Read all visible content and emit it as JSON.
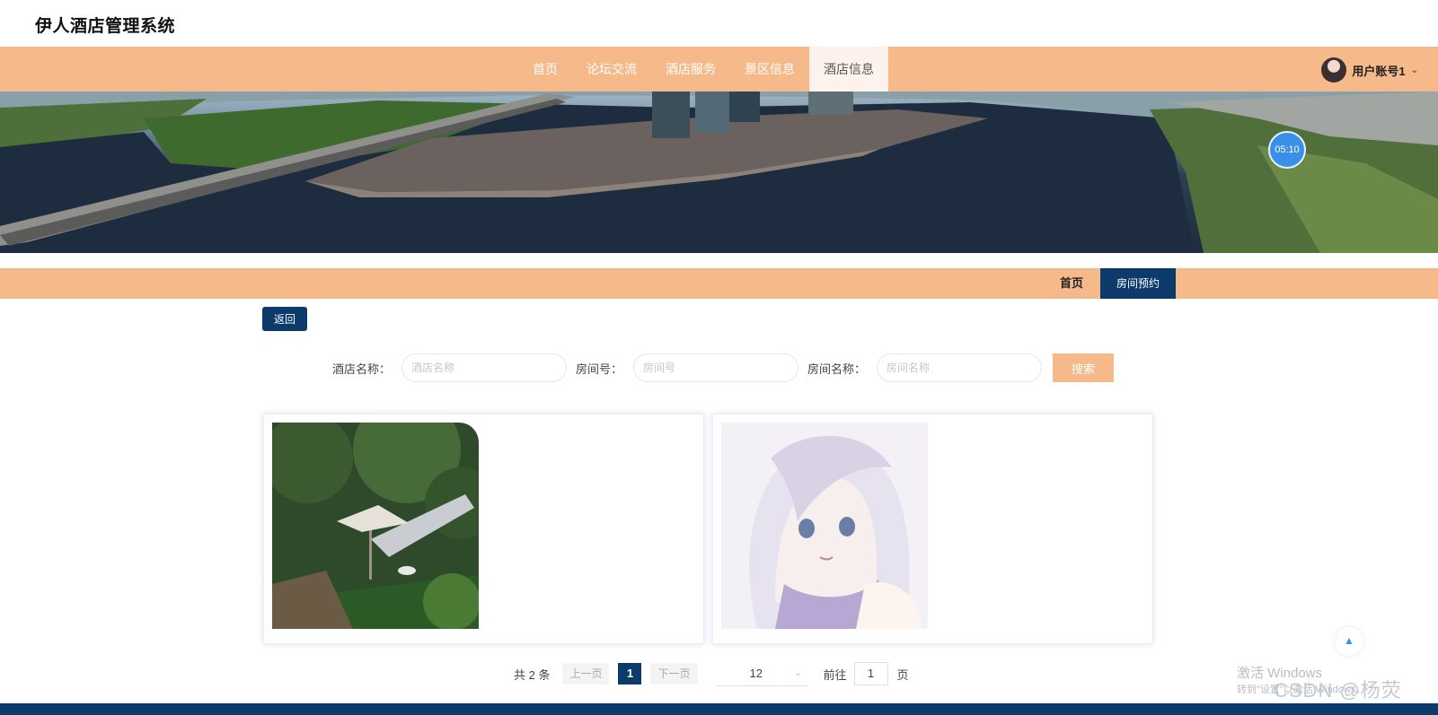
{
  "app": {
    "title": "伊人酒店管理系统"
  },
  "nav": {
    "items": [
      {
        "label": "首页"
      },
      {
        "label": "论坛交流"
      },
      {
        "label": "酒店服务"
      },
      {
        "label": "景区信息"
      },
      {
        "label": "酒店信息"
      }
    ],
    "active_index": 4
  },
  "user": {
    "name": "用户账号1"
  },
  "timer": {
    "text": "05:10"
  },
  "breadcrumb": {
    "home": "首页",
    "current": "房间预约"
  },
  "back": {
    "label": "返回"
  },
  "search": {
    "fields": [
      {
        "label": "酒店名称：",
        "placeholder": "酒店名称",
        "value": ""
      },
      {
        "label": "房间号：",
        "placeholder": "房间号",
        "value": ""
      },
      {
        "label": "房间名称：",
        "placeholder": "房间名称",
        "value": ""
      }
    ],
    "button": "搜索"
  },
  "pagination": {
    "total": "共 2 条",
    "prev": "上一页",
    "current": "1",
    "next": "下一页",
    "page_size": "12",
    "goto_label": "前往",
    "goto_value": "1",
    "page_unit": "页"
  },
  "watermark": {
    "line1": "激活 Windows",
    "line2": "转到\"设置\"以激活 Windows。",
    "csdn": "CSDN @杨荧"
  },
  "colors": {
    "accent": "#f5b98a",
    "primary": "#0b3a6b",
    "timer": "#3a8fe8"
  },
  "icons": {
    "avatar": "avatar-icon",
    "dropdown": "chevron-down-icon",
    "scroll_top": "arrow-up-icon"
  }
}
